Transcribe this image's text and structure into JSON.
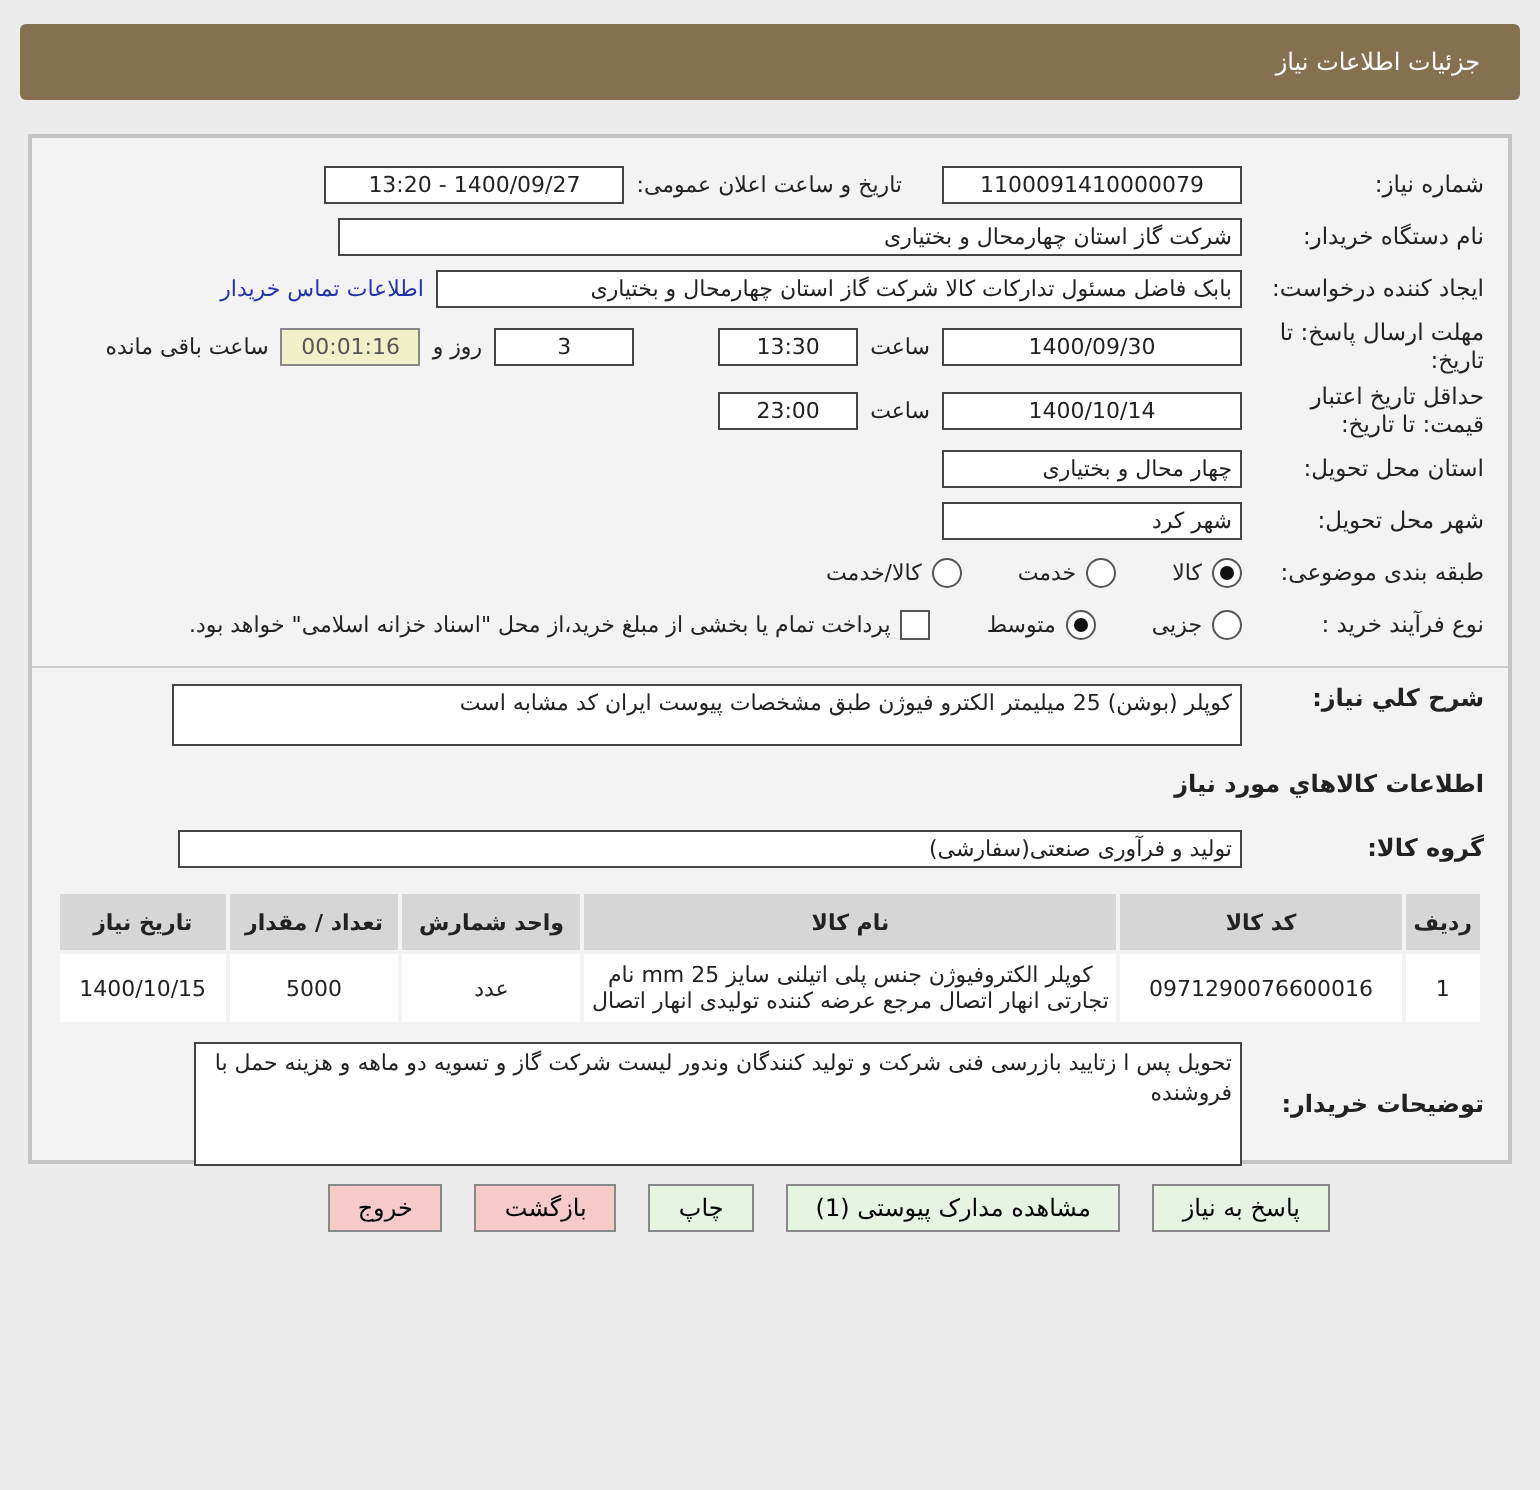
{
  "header": {
    "title": "جزئیات اطلاعات نیاز"
  },
  "need_number": {
    "label": "شماره نیاز:",
    "value": "1100091410000079"
  },
  "announce": {
    "label": "تاریخ و ساعت اعلان عمومی:",
    "value": "1400/09/27 - 13:20"
  },
  "buyer": {
    "label": "نام دستگاه خریدار:",
    "value": "شرکت گاز استان چهارمحال و بختیاری"
  },
  "requester": {
    "label": "ایجاد کننده درخواست:",
    "value": "بابک فاضل  مسئول تدارکات کالا شرکت گاز استان چهارمحال و بختیاری",
    "link": "اطلاعات تماس خریدار"
  },
  "deadline": {
    "label": "مهلت ارسال پاسخ: تا تاریخ:",
    "date": "1400/09/30",
    "time_label": "ساعت",
    "time": "13:30",
    "days": "3",
    "days_label": "روز و",
    "remaining": "00:01:16",
    "remaining_label": "ساعت باقی مانده"
  },
  "validity": {
    "label": "حداقل تاریخ اعتبار قیمت: تا تاریخ:",
    "date": "1400/10/14",
    "time_label": "ساعت",
    "time": "23:00"
  },
  "province": {
    "label": "استان محل تحویل:",
    "value": "چهار محال و بختیاری"
  },
  "city": {
    "label": "شهر محل تحویل:",
    "value": "شهر کرد"
  },
  "category": {
    "label": "طبقه بندی موضوعی:",
    "options": [
      {
        "label": "کالا",
        "selected": true
      },
      {
        "label": "خدمت",
        "selected": false
      },
      {
        "label": "کالا/خدمت",
        "selected": false
      }
    ]
  },
  "purchase_type": {
    "label": "نوع فرآیند خرید :",
    "options": [
      {
        "label": "جزیی",
        "selected": false
      },
      {
        "label": "متوسط",
        "selected": true
      }
    ],
    "payment": {
      "label": "پرداخت تمام یا بخشی از مبلغ خرید،از محل \"اسناد خزانه اسلامی\" خواهد بود.",
      "checked": false
    }
  },
  "summary": {
    "label": "شرح کلي نياز:",
    "value": "کوپلر (بوشن) 25 میلیمتر الکترو فیوژن طبق مشخصات پیوست ایران کد مشابه است"
  },
  "goods_heading": "اطلاعات کالاهاي مورد نياز",
  "group": {
    "label": "گروه کالا:",
    "value": "تولید و فرآوری صنعتی(سفارشی)"
  },
  "table": {
    "columns": [
      "ردیف",
      "کد کالا",
      "نام کالا",
      "واحد شمارش",
      "تعداد / مقدار",
      "تاریخ نیاز"
    ],
    "rows": [
      [
        "1",
        "0971290076600016",
        "کوپلر الکتروفیوژن جنس پلی اتیلنی سایز 25 mm نام تجارتی انهار اتصال مرجع عرضه کننده تولیدی انهار اتصال",
        "عدد",
        "5000",
        "1400/10/15"
      ]
    ]
  },
  "notes": {
    "label": "توضیحات خریدار:",
    "value": "تحویل پس ا زتایید بازرسی فنی شرکت و تولید کنندگان وندور لیست شرکت گاز و تسویه دو ماهه و هزینه حمل با فروشنده"
  },
  "buttons": [
    {
      "label": "پاسخ به نیاز",
      "kind": "normal"
    },
    {
      "label": "مشاهده مدارک پیوستی (1)",
      "kind": "normal"
    },
    {
      "label": "چاپ",
      "kind": "normal"
    },
    {
      "label": "بازگشت",
      "kind": "exit"
    },
    {
      "label": "خروج",
      "kind": "exit"
    }
  ]
}
